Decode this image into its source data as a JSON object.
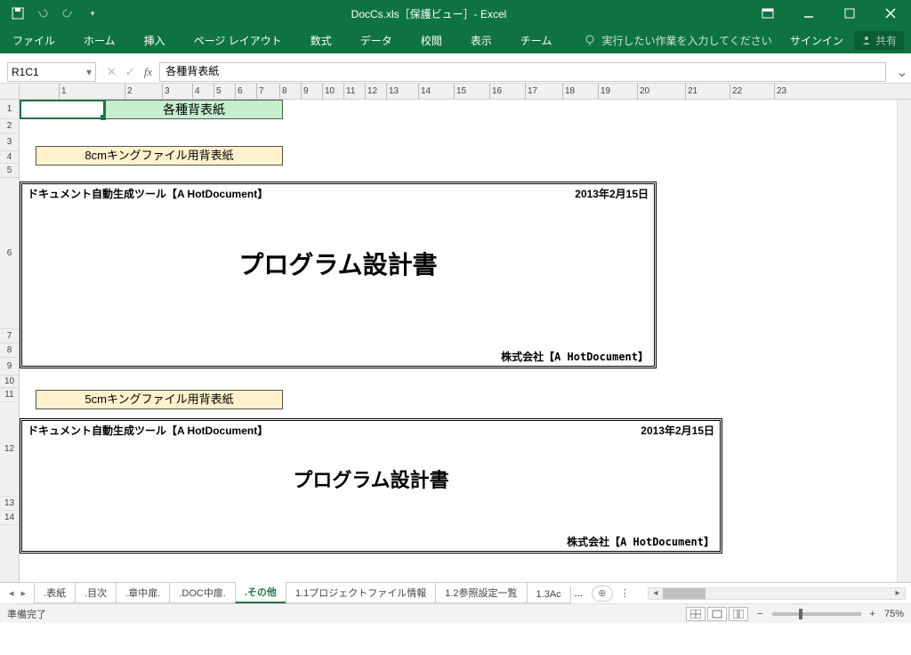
{
  "titlebar": {
    "title": "DocCs.xls［保護ビュー］- Excel"
  },
  "ribbon": {
    "tabs": [
      "ファイル",
      "ホーム",
      "挿入",
      "ページ レイアウト",
      "数式",
      "データ",
      "校閲",
      "表示",
      "チーム"
    ],
    "tellme": "実行したい作業を入力してください",
    "signin": "サインイン",
    "share": "共有"
  },
  "namebox": {
    "ref": "R1C1"
  },
  "formula": {
    "value": "各種背表紙"
  },
  "ruler": {
    "ticks": [
      "1",
      "2",
      "3",
      "4",
      "5",
      "6",
      "7",
      "8",
      "9",
      "10",
      "11",
      "12",
      "13",
      "14",
      "15",
      "16",
      "17",
      "18",
      "19",
      "20",
      "21",
      "22",
      "23"
    ]
  },
  "rows": [
    "1",
    "2",
    "3",
    "4",
    "5",
    "6",
    "7",
    "8",
    "9",
    "10",
    "11",
    "12",
    "13",
    "14"
  ],
  "cells": {
    "title": "各種背表紙",
    "label8": "8cmキングファイル用背表紙",
    "label5": "5cmキングファイル用背表紙"
  },
  "spine1": {
    "tool": "ドキュメント自動生成ツール【A HotDocument】",
    "date": "2013年2月15日",
    "title": "プログラム設計書",
    "company": "株式会社【A HotDocument】"
  },
  "spine2": {
    "tool": "ドキュメント自動生成ツール【A HotDocument】",
    "date": "2013年2月15日",
    "title": "プログラム設計書",
    "company": "株式会社【A HotDocument】"
  },
  "sheets": {
    "tabs": [
      ".表紙",
      ".目次",
      ".章中扉.",
      ".DOC中扉.",
      ".その他",
      "1.1プロジェクトファイル情報",
      "1.2参照設定一覧",
      "1.3Ac"
    ],
    "active": 4,
    "more": "..."
  },
  "status": {
    "ready": "準備完了",
    "zoom": "75%",
    "minus": "−",
    "plus": "+"
  }
}
